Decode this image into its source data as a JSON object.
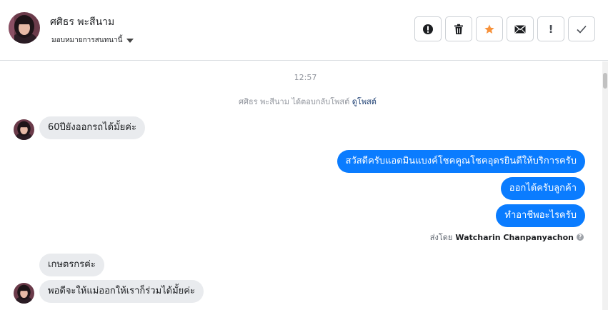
{
  "header": {
    "contact_name": "ศศิธร พะสีนาม",
    "assign_label": "มอบหมายการสนทนานี้",
    "actions": [
      {
        "icon": "alert-circle-icon",
        "label": ""
      },
      {
        "icon": "trash-icon",
        "label": ""
      },
      {
        "icon": "star-icon",
        "label": ""
      },
      {
        "icon": "envelope-icon",
        "label": ""
      },
      {
        "icon": "exclamation-icon",
        "label": "!"
      },
      {
        "icon": "check-icon",
        "label": ""
      }
    ],
    "star_color": "#f7923b"
  },
  "conversation": {
    "timestamp": "12:57",
    "system_message": {
      "text": "ศศิธร พะสีนาม ได้ตอบกลับโพสต์",
      "link": "ดูโพสต์"
    },
    "messages": [
      {
        "direction": "in",
        "text": "60ปียังออกรถได้มั้ยค่ะ"
      },
      {
        "direction": "out",
        "text": "สวัสดีครับแอดมินแบงค์โชคคูณโชคอุดรยินดีให้บริการครับ"
      },
      {
        "direction": "out",
        "text": "ออกได้ครับลูกค้า"
      },
      {
        "direction": "out",
        "text": "ทำอาชีพอะไรครับ"
      },
      {
        "direction": "in",
        "text": "เกษตรกรค่ะ"
      },
      {
        "direction": "in",
        "text": "พอดีจะให้แม่ออกให้เราก็ร่วมได้มั้ยค่ะ"
      }
    ],
    "sent_by_label": "ส่งโดย",
    "sent_by_agent": "Watcharin Chanpanyachon",
    "outgoing_color": "#0a7cff",
    "incoming_color": "#e9ebee"
  }
}
